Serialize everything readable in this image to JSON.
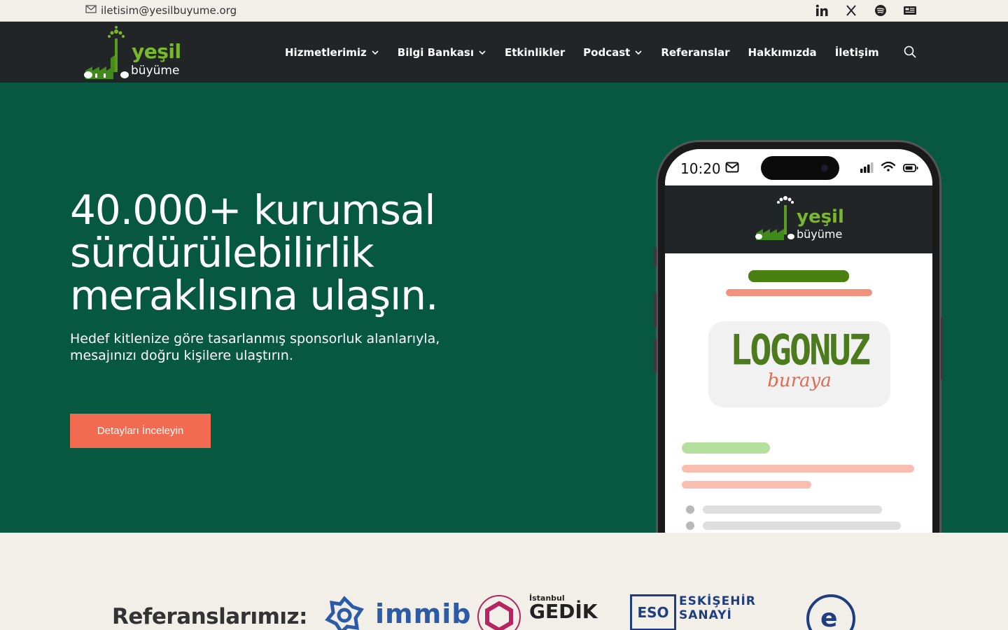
{
  "topbar": {
    "email": "iletisim@yesilbuyume.org",
    "social_icons": [
      "linkedin-icon",
      "x-icon",
      "spotify-icon",
      "newsletter-icon"
    ]
  },
  "nav": {
    "logo_word1": "yeşil",
    "logo_word2": "büyüme",
    "items": [
      {
        "label": "Hizmetlerimiz",
        "has_dropdown": true
      },
      {
        "label": "Bilgi Bankası",
        "has_dropdown": true
      },
      {
        "label": "Etkinlikler",
        "has_dropdown": false
      },
      {
        "label": "Podcast",
        "has_dropdown": true
      },
      {
        "label": "Referanslar",
        "has_dropdown": false
      },
      {
        "label": "Hakkımızda",
        "has_dropdown": false
      },
      {
        "label": "İletişim",
        "has_dropdown": false
      }
    ]
  },
  "hero": {
    "heading": "40.000+ kurumsal sürdürülebilirlik meraklısına ulaşın.",
    "subtext": "Hedef kitlenize göre tasarlanmış sponsorluk alanlarıyla, mesajınızı doğru kişilere ulaştırın.",
    "cta_label": "Detayları İnceleyin"
  },
  "phone": {
    "time": "10:20",
    "logo_word1": "yeşil",
    "logo_word2": "büyüme",
    "placeholder_logo": "LOGONUZ",
    "placeholder_script": "buraya"
  },
  "references": {
    "title": "Referanslarımız:",
    "immib": "immib",
    "gedik_small": "İstanbul",
    "gedik_big": "GEDİK",
    "eso_box": "ESO",
    "eso_line1": "ESKİŞEHİR",
    "eso_line2": "SANAYİ",
    "ege": "e"
  },
  "colors": {
    "hero_bg": "#075840",
    "nav_bg": "#222527",
    "accent": "#f26a4f",
    "brand_green": "#78b82a",
    "page_bg": "#f2efe9"
  }
}
